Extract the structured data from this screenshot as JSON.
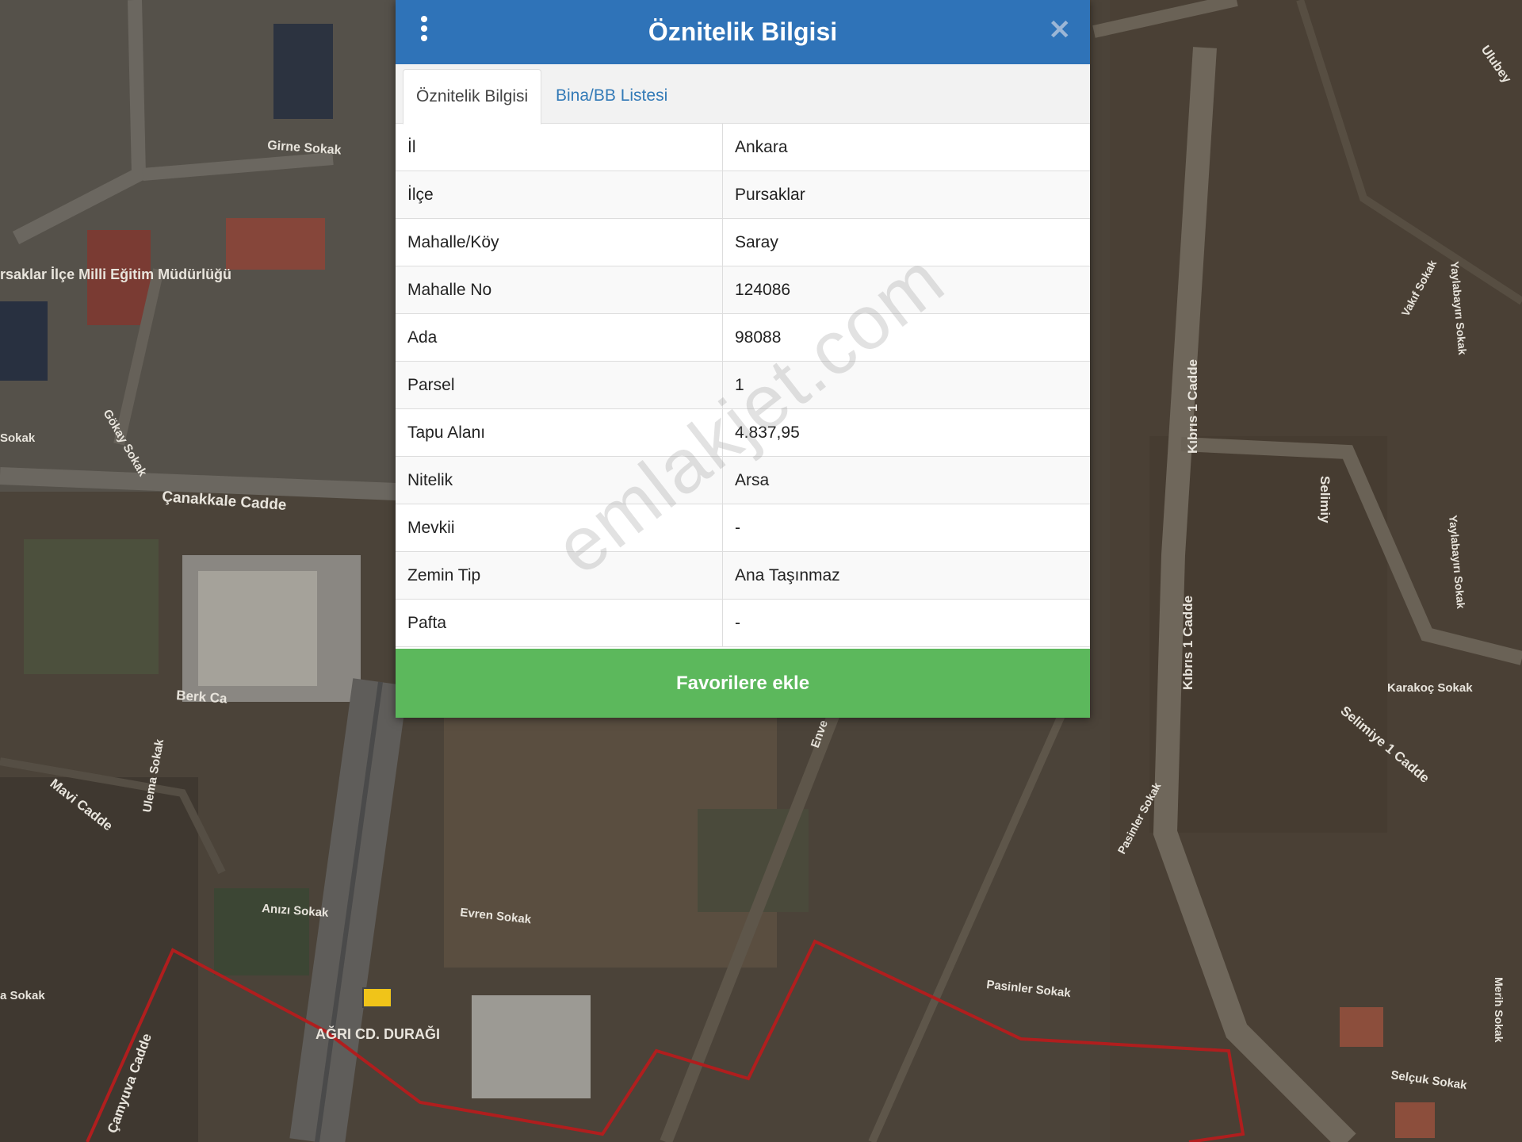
{
  "panel": {
    "title": "Öznitelik Bilgisi",
    "close_icon": "close-icon",
    "menu_icon": "kebab-menu-icon",
    "tabs": [
      {
        "label": "Öznitelik Bilgisi",
        "active": true
      },
      {
        "label": "Bina/BB Listesi",
        "active": false
      }
    ],
    "rows": [
      {
        "key": "İl",
        "value": "Ankara"
      },
      {
        "key": "İlçe",
        "value": "Pursaklar"
      },
      {
        "key": "Mahalle/Köy",
        "value": "Saray"
      },
      {
        "key": "Mahalle No",
        "value": "124086"
      },
      {
        "key": "Ada",
        "value": "98088"
      },
      {
        "key": "Parsel",
        "value": "1"
      },
      {
        "key": "Tapu Alanı",
        "value": "4.837,95"
      },
      {
        "key": "Nitelik",
        "value": "Arsa"
      },
      {
        "key": "Mevkii",
        "value": "-"
      },
      {
        "key": "Zemin Tip",
        "value": "Ana Taşınmaz"
      },
      {
        "key": "Pafta",
        "value": "-"
      }
    ],
    "favorite_button": "Favorilere ekle",
    "header_color": "#2f73b8",
    "button_color": "#5cb85c"
  },
  "watermark": "emlakjet.com",
  "map": {
    "labels": [
      "Girne Sokak",
      "rsaklar İlçe Milli Eğitim Müdürlüğü",
      "Çanakkale Cadde",
      "Gökay Sokak",
      "Sokak",
      "Berk Ca",
      "Mavi Cadde",
      "Ulema Sokak",
      "Anızı Sokak",
      "Evren Sokak",
      "AĞRI CD. DURAĞI",
      "Çamyuva Cadde",
      "a Sokak",
      "Kıbrıs 1 Cadde",
      "Kıbrıs 1 Cadde",
      "Selimiy",
      "Vakıf Sokak",
      "Yaylabayırı Sokak",
      "Yaylabayırı Sokak",
      "Ulubey",
      "Karakoç Sokak",
      "Selimiye 1 Cadde",
      "Pasinler Sokak",
      "Pasinler Sokak",
      "Selçuk Sokak",
      "Merih Sokak",
      "Enve"
    ],
    "parcel_color": "#b01e1e"
  }
}
